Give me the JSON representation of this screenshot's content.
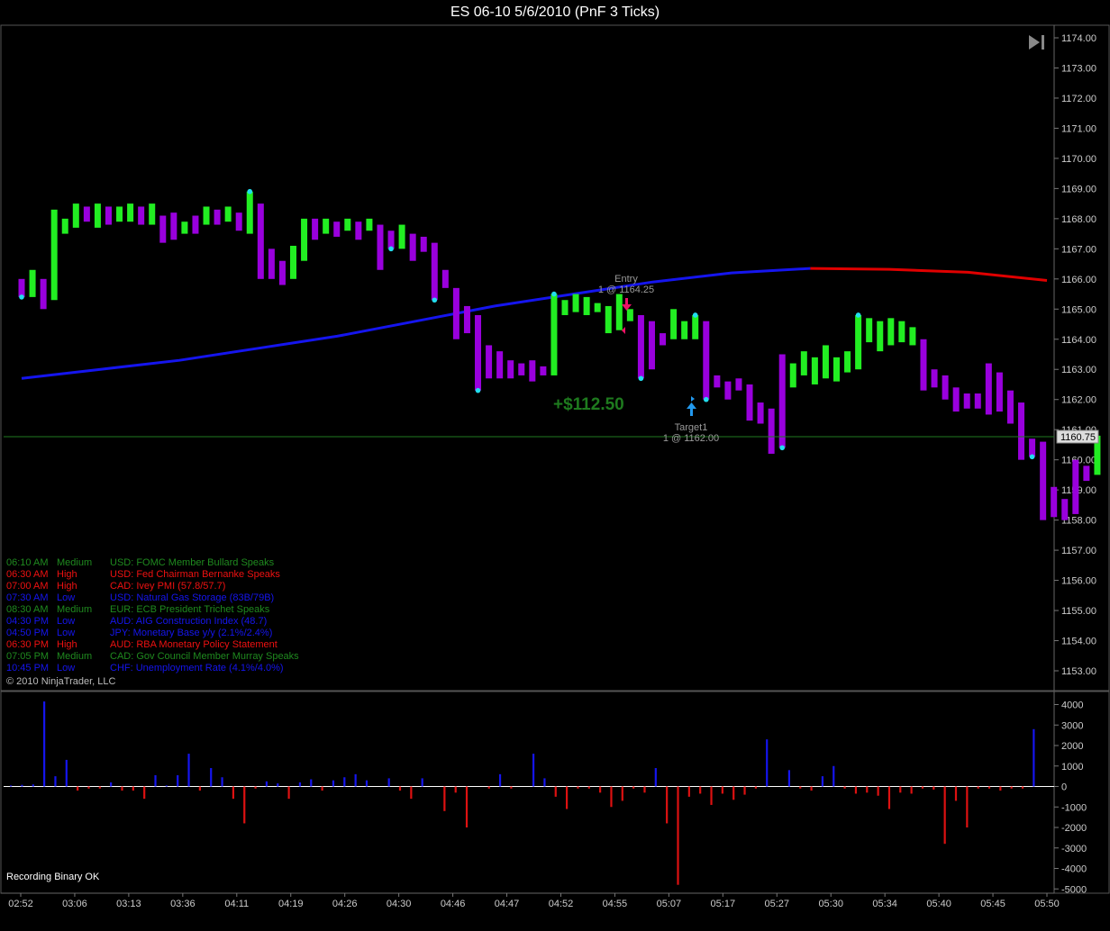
{
  "window": {
    "title": "ES 06-10  5/6/2010 (PnF 3 Ticks)"
  },
  "colors": {
    "background": "#000000",
    "up_bar": "#22ee22",
    "down_bar": "#9900dd",
    "dot": "#22ddee",
    "ma_line": "#1515ee",
    "ma_line_right": "#e00000",
    "last_price_line": "#1f7a1f",
    "volume_up": "#1515ee",
    "volume_down": "#dd1111",
    "zero_line": "#ffffff",
    "entry_arrow": "#ee1166",
    "target_arrow": "#2299ee",
    "pnl": "#1e7a1e"
  },
  "icons": {
    "nav_end": "skip-to-end-icon",
    "entry": "down-arrow-icon",
    "target": "up-arrow-icon"
  },
  "price_axis": {
    "ticks": [
      "1174.00",
      "1173.00",
      "1172.00",
      "1171.00",
      "1170.00",
      "1169.00",
      "1168.00",
      "1167.00",
      "1166.00",
      "1165.00",
      "1164.00",
      "1163.00",
      "1162.00",
      "1161.00",
      "1160.00",
      "1159.00",
      "1158.00",
      "1157.00",
      "1156.00",
      "1155.00",
      "1154.00",
      "1153.00"
    ],
    "last_price": "1160.75"
  },
  "volume_axis": {
    "ticks": [
      "4000",
      "3000",
      "2000",
      "1000",
      "0",
      "-1000",
      "-2000",
      "-3000",
      "-4000",
      "-5000"
    ]
  },
  "time_axis": {
    "labels": [
      "02:52",
      "03:06",
      "03:13",
      "03:36",
      "04:11",
      "04:19",
      "04:26",
      "04:30",
      "04:46",
      "04:47",
      "04:52",
      "04:55",
      "05:07",
      "05:17",
      "05:27",
      "05:30",
      "05:34",
      "05:40",
      "05:45",
      "05:50"
    ]
  },
  "trade": {
    "entry_label": "Entry",
    "entry_detail": "1 @ 1164.25",
    "target_label": "Target1",
    "target_detail": "1 @ 1162.00",
    "pnl": "+$112.50"
  },
  "news": [
    {
      "time": "06:10 AM",
      "impact": "Medium",
      "text": "USD: FOMC Member Bullard Speaks",
      "color": "#1f8a1f"
    },
    {
      "time": "06:30 AM",
      "impact": "High",
      "text": "USD: Fed Chairman Bernanke Speaks",
      "color": "#ee1111"
    },
    {
      "time": "07:00 AM",
      "impact": "High",
      "text": "CAD: Ivey PMI (57.8/57.7)",
      "color": "#ee1111"
    },
    {
      "time": "07:30 AM",
      "impact": "Low",
      "text": "USD: Natural Gas Storage (83B/79B)",
      "color": "#1515ee"
    },
    {
      "time": "08:30 AM",
      "impact": "Medium",
      "text": "EUR: ECB President Trichet Speaks",
      "color": "#1f8a1f"
    },
    {
      "time": "04:30 PM",
      "impact": "Low",
      "text": "AUD: AIG Construction Index (48.7)",
      "color": "#1515ee"
    },
    {
      "time": "04:50 PM",
      "impact": "Low",
      "text": "JPY: Monetary Base y/y (2.1%/2.4%)",
      "color": "#1515ee"
    },
    {
      "time": "06:30 PM",
      "impact": "High",
      "text": "AUD: RBA Monetary Policy Statement",
      "color": "#ee1111"
    },
    {
      "time": "07:05 PM",
      "impact": "Medium",
      "text": "CAD: Gov Council Member Murray Speaks",
      "color": "#1f8a1f"
    },
    {
      "time": "10:45 PM",
      "impact": "Low",
      "text": "CHF: Unemployment Rate (4.1%/4.0%)",
      "color": "#1515ee"
    }
  ],
  "copyright": "© 2010 NinjaTrader, LLC",
  "status": "Recording Binary OK",
  "chart_data": {
    "type": "bar",
    "description_units": "price bars (low/high, points) and signed volume per bar",
    "price_range": [
      1152.5,
      1174.3
    ],
    "volume_range": [
      -5000,
      4300
    ],
    "price_bars": [
      [
        1165.4,
        1166.0,
        "down"
      ],
      [
        1165.4,
        1166.3,
        "up"
      ],
      [
        1165.0,
        1166.0,
        "down"
      ],
      [
        1165.3,
        1168.3,
        "up"
      ],
      [
        1167.5,
        1168.0,
        "up"
      ],
      [
        1167.7,
        1168.5,
        "up"
      ],
      [
        1167.9,
        1168.4,
        "down"
      ],
      [
        1167.7,
        1168.5,
        "up"
      ],
      [
        1167.8,
        1168.4,
        "down"
      ],
      [
        1167.9,
        1168.4,
        "up"
      ],
      [
        1167.9,
        1168.5,
        "up"
      ],
      [
        1167.8,
        1168.4,
        "down"
      ],
      [
        1167.8,
        1168.5,
        "up"
      ],
      [
        1167.2,
        1168.1,
        "down"
      ],
      [
        1167.3,
        1168.2,
        "down"
      ],
      [
        1167.5,
        1167.9,
        "up"
      ],
      [
        1167.5,
        1168.1,
        "down"
      ],
      [
        1167.8,
        1168.4,
        "up"
      ],
      [
        1167.8,
        1168.3,
        "down"
      ],
      [
        1167.9,
        1168.4,
        "up"
      ],
      [
        1167.6,
        1168.2,
        "down"
      ],
      [
        1167.5,
        1168.9,
        "up"
      ],
      [
        1166.0,
        1168.5,
        "down"
      ],
      [
        1166.0,
        1167.0,
        "down"
      ],
      [
        1165.8,
        1166.6,
        "down"
      ],
      [
        1166.0,
        1167.1,
        "up"
      ],
      [
        1166.6,
        1168.0,
        "up"
      ],
      [
        1167.3,
        1168.0,
        "down"
      ],
      [
        1167.5,
        1168.0,
        "up"
      ],
      [
        1167.4,
        1167.9,
        "down"
      ],
      [
        1167.6,
        1168.0,
        "up"
      ],
      [
        1167.3,
        1167.9,
        "down"
      ],
      [
        1167.6,
        1168.0,
        "up"
      ],
      [
        1166.3,
        1167.8,
        "down"
      ],
      [
        1167.0,
        1167.6,
        "down"
      ],
      [
        1167.0,
        1167.8,
        "up"
      ],
      [
        1166.6,
        1167.5,
        "down"
      ],
      [
        1166.9,
        1167.4,
        "down"
      ],
      [
        1165.3,
        1167.2,
        "down"
      ],
      [
        1165.7,
        1166.3,
        "down"
      ],
      [
        1164.0,
        1165.7,
        "down"
      ],
      [
        1164.2,
        1165.1,
        "down"
      ],
      [
        1162.3,
        1164.8,
        "down"
      ],
      [
        1162.7,
        1163.8,
        "down"
      ],
      [
        1162.7,
        1163.6,
        "down"
      ],
      [
        1162.7,
        1163.3,
        "down"
      ],
      [
        1162.8,
        1163.2,
        "down"
      ],
      [
        1162.6,
        1163.3,
        "down"
      ],
      [
        1162.8,
        1163.1,
        "down"
      ],
      [
        1162.8,
        1165.5,
        "up"
      ],
      [
        1164.8,
        1165.3,
        "up"
      ],
      [
        1164.9,
        1165.5,
        "up"
      ],
      [
        1164.8,
        1165.4,
        "up"
      ],
      [
        1164.9,
        1165.2,
        "up"
      ],
      [
        1164.2,
        1165.1,
        "up"
      ],
      [
        1164.3,
        1165.5,
        "up"
      ],
      [
        1164.6,
        1165.0,
        "up"
      ],
      [
        1162.7,
        1164.8,
        "down"
      ],
      [
        1163.0,
        1164.6,
        "down"
      ],
      [
        1163.8,
        1164.2,
        "down"
      ],
      [
        1164.0,
        1165.0,
        "up"
      ],
      [
        1164.0,
        1164.6,
        "up"
      ],
      [
        1164.0,
        1164.8,
        "up"
      ],
      [
        1162.0,
        1164.6,
        "down"
      ],
      [
        1162.4,
        1162.8,
        "down"
      ],
      [
        1162.0,
        1162.6,
        "down"
      ],
      [
        1162.3,
        1162.7,
        "down"
      ],
      [
        1161.3,
        1162.5,
        "down"
      ],
      [
        1161.2,
        1161.9,
        "down"
      ],
      [
        1160.2,
        1161.7,
        "down"
      ],
      [
        1160.4,
        1163.5,
        "down"
      ],
      [
        1162.4,
        1163.2,
        "up"
      ],
      [
        1162.8,
        1163.6,
        "up"
      ],
      [
        1162.5,
        1163.4,
        "up"
      ],
      [
        1162.7,
        1163.8,
        "up"
      ],
      [
        1162.6,
        1163.4,
        "up"
      ],
      [
        1162.9,
        1163.6,
        "up"
      ],
      [
        1163.0,
        1164.8,
        "up"
      ],
      [
        1163.9,
        1164.7,
        "up"
      ],
      [
        1163.6,
        1164.6,
        "up"
      ],
      [
        1163.8,
        1164.7,
        "up"
      ],
      [
        1163.9,
        1164.6,
        "up"
      ],
      [
        1163.8,
        1164.4,
        "up"
      ],
      [
        1162.3,
        1164.0,
        "down"
      ],
      [
        1162.4,
        1163.0,
        "down"
      ],
      [
        1162.0,
        1162.8,
        "down"
      ],
      [
        1161.6,
        1162.4,
        "down"
      ],
      [
        1161.7,
        1162.2,
        "down"
      ],
      [
        1161.7,
        1162.2,
        "down"
      ],
      [
        1161.5,
        1163.2,
        "down"
      ],
      [
        1161.6,
        1162.9,
        "down"
      ],
      [
        1161.2,
        1162.3,
        "down"
      ],
      [
        1160.0,
        1161.9,
        "down"
      ],
      [
        1160.1,
        1160.7,
        "down"
      ],
      [
        1158.0,
        1160.6,
        "down"
      ],
      [
        1158.1,
        1159.1,
        "down"
      ],
      [
        1158.0,
        1158.7,
        "down"
      ],
      [
        1158.2,
        1160.0,
        "down"
      ],
      [
        1159.3,
        1159.8,
        "down"
      ],
      [
        1159.5,
        1160.8,
        "up"
      ]
    ],
    "dots_at_bar": [
      0,
      21,
      34,
      38,
      42,
      49,
      57,
      62,
      63,
      70,
      77,
      93
    ],
    "ma_series": [
      1162.7,
      1163.0,
      1163.3,
      1163.7,
      1164.1,
      1164.6,
      1165.1,
      1165.5,
      1165.9,
      1166.2,
      1166.35,
      1166.32,
      1166.22,
      1165.95
    ],
    "volumes": [
      50,
      80,
      100,
      4150,
      500,
      1300,
      -200,
      -100,
      -100,
      200,
      -200,
      -200,
      -600,
      550,
      50,
      550,
      1600,
      -200,
      900,
      450,
      -600,
      -1800,
      -100,
      250,
      150,
      -600,
      200,
      350,
      -200,
      300,
      450,
      600,
      300,
      0,
      400,
      -200,
      -600,
      400,
      0,
      -1200,
      -300,
      -2000,
      0,
      -100,
      600,
      -100,
      0,
      1600,
      400,
      -500,
      -1100,
      -100,
      -100,
      -300,
      -1000,
      -700,
      -100,
      -300,
      900,
      -1800,
      -4800,
      -500,
      -350,
      -900,
      -350,
      -650,
      -400,
      -100,
      2300,
      0,
      800,
      -100,
      -200,
      500,
      1000,
      -100,
      -350,
      -300,
      -450,
      -1100,
      -300,
      -350,
      -100,
      -150,
      -2800,
      -700,
      -2000,
      -100,
      -100,
      -200,
      -100,
      -100,
      2800
    ],
    "ylabel": "",
    "xlabel": ""
  }
}
